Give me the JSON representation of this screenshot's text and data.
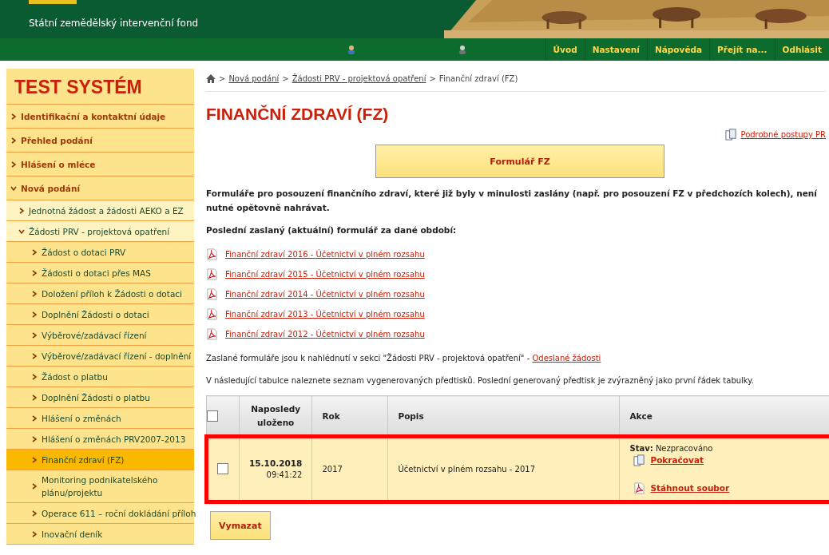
{
  "header": {
    "subtitle": "Státní zemědělský intervenční fond"
  },
  "nav": {
    "links": [
      "Úvod",
      "Nastavení",
      "Nápověda",
      "Přejít na...",
      "Odhlásit"
    ]
  },
  "sidebar": {
    "title": "TEST SYSTÉM",
    "items": [
      {
        "label": "Identifikační a kontaktní údaje",
        "expanded": false,
        "selected": false
      },
      {
        "label": "Přehled podání",
        "expanded": false,
        "selected": false
      },
      {
        "label": "Hlášení o mléce",
        "expanded": false,
        "selected": false
      },
      {
        "label": "Nová podání",
        "expanded": true,
        "selected": false,
        "children": [
          {
            "label": "Jednotná žádost a žádosti AEKO a EZ",
            "expanded": false,
            "selected": false
          },
          {
            "label": "Žádosti PRV - projektová opatření",
            "expanded": true,
            "selected": false,
            "children": [
              {
                "label": "Žádost o dotaci PRV",
                "expanded": false,
                "selected": false
              },
              {
                "label": "Žádosti o dotaci přes MAS",
                "expanded": false,
                "selected": false
              },
              {
                "label": "Doložení příloh k Žádosti o dotaci",
                "expanded": false,
                "selected": false
              },
              {
                "label": "Doplnění Žádosti o dotaci",
                "expanded": false,
                "selected": false
              },
              {
                "label": "Výběrové/zadávací řízení",
                "expanded": false,
                "selected": false
              },
              {
                "label": "Výběrové/zadávací řízení - doplnění",
                "expanded": false,
                "selected": false
              },
              {
                "label": "Žádost o platbu",
                "expanded": false,
                "selected": false
              },
              {
                "label": "Doplnění Žádosti o platbu",
                "expanded": false,
                "selected": false
              },
              {
                "label": "Hlášení o změnách",
                "expanded": false,
                "selected": false
              },
              {
                "label": "Hlášení o změnách PRV2007-2013",
                "expanded": false,
                "selected": false
              },
              {
                "label": "Finanční zdraví (FZ)",
                "expanded": false,
                "selected": true
              },
              {
                "label": "Monitoring podnikatelského plánu/projektu",
                "expanded": false,
                "selected": false
              },
              {
                "label": "Operace 611 – roční dokládání příloh",
                "expanded": false,
                "selected": false
              },
              {
                "label": "Inovační deník",
                "expanded": false,
                "selected": false
              }
            ]
          }
        ]
      }
    ]
  },
  "breadcrumb": [
    {
      "separator": ">",
      "label": "Nová podání"
    },
    {
      "separator": ">",
      "label": "Žádosti PRV - projektová opatření"
    },
    {
      "separator": ">",
      "label": "Finanční zdraví (FZ)"
    }
  ],
  "title": "FINANČNÍ ZDRAVÍ (FZ)",
  "procedures_link": "Podrobné postupy PR",
  "form_button": "Formulář FZ",
  "intro": "Formuláře pro posouzení finančního zdraví, které již byly v minulosti zaslány (např. pro posouzení FZ v předchozích kolech), není nutné opětovně nahrávat.",
  "last_sent_heading": "Poslední zaslaný (aktuální) formulář za dané období:",
  "pdf_links": [
    "Finanční zdraví 2016 - Účetnictví v plném rozsahu",
    "Finanční zdraví 2015 - Účetnictví v plném rozsahu",
    "Finanční zdraví 2014 - Účetnictví v plném rozsahu",
    "Finanční zdraví 2013 - Účetnictví v plném rozsahu",
    "Finanční zdraví 2012 - Účetnictví v plném rozsahu"
  ],
  "sent_note": {
    "text": "Zaslané formuláře jsou k nahlédnutí v sekci \"Žádosti PRV - projektová opatření\" - ",
    "link": "Odeslané žádosti"
  },
  "table_note": "V následující tabulce naleznete seznam vygenerovaných předtisků. Poslední generovaný předtisk je zvýrazněný jako první řádek tabulky.",
  "table": {
    "select_all_checked": false,
    "columns": [
      "Naposledy uloženo",
      "Rok",
      "Popis",
      "Akce"
    ],
    "rows": [
      {
        "checked": false,
        "highlighted": true,
        "date": "15.10.2018",
        "time": "09:41:22",
        "year": "2017",
        "description": "Účetnictví v plném rozsahu - 2017",
        "status_label": "Stav:",
        "status": "Nezpracováno",
        "actions": [
          "Pokračovat",
          "Stáhnout soubor"
        ]
      }
    ]
  },
  "delete_button": "Vymazat"
}
